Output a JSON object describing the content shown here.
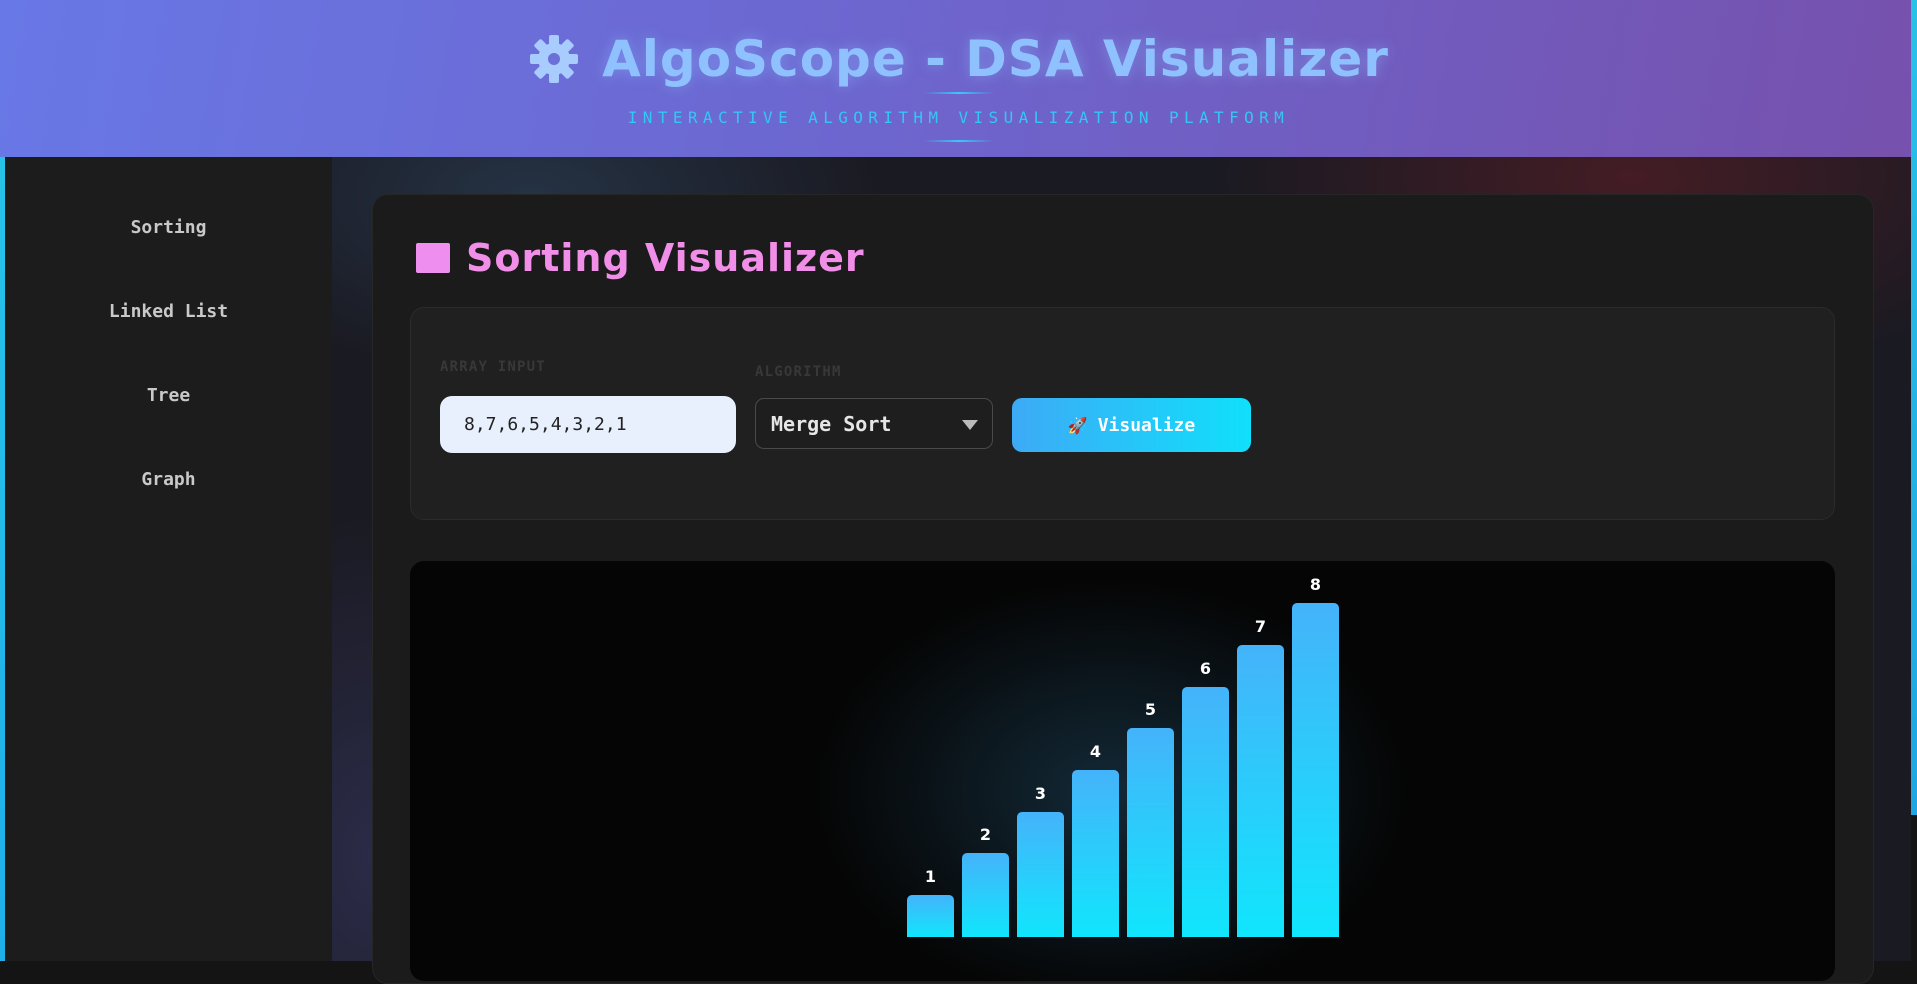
{
  "header": {
    "title": "AlgoScope - DSA Visualizer",
    "subtitle": "INTERACTIVE ALGORITHM VISUALIZATION PLATFORM",
    "icon": "gear-icon"
  },
  "sidebar": {
    "items": [
      {
        "label": "Sorting"
      },
      {
        "label": "Linked List"
      },
      {
        "label": "Tree"
      },
      {
        "label": "Graph"
      }
    ]
  },
  "panel": {
    "title": "Sorting Visualizer",
    "title_icon": "square-icon",
    "title_color": "#f08ee8"
  },
  "controls": {
    "array_label": "ARRAY INPUT",
    "array_value": "8,7,6,5,4,3,2,1",
    "algorithm_label": "ALGORITHM",
    "algorithm_selected": "Merge Sort",
    "visualize_label": "Visualize",
    "visualize_icon": "🚀"
  },
  "chart_data": {
    "type": "bar",
    "categories": [
      "1",
      "2",
      "3",
      "4",
      "5",
      "6",
      "7",
      "8"
    ],
    "values": [
      1,
      2,
      3,
      4,
      5,
      6,
      7,
      8
    ],
    "bar_color_top": "#45b3fa",
    "bar_color_bottom": "#10e6fd"
  }
}
